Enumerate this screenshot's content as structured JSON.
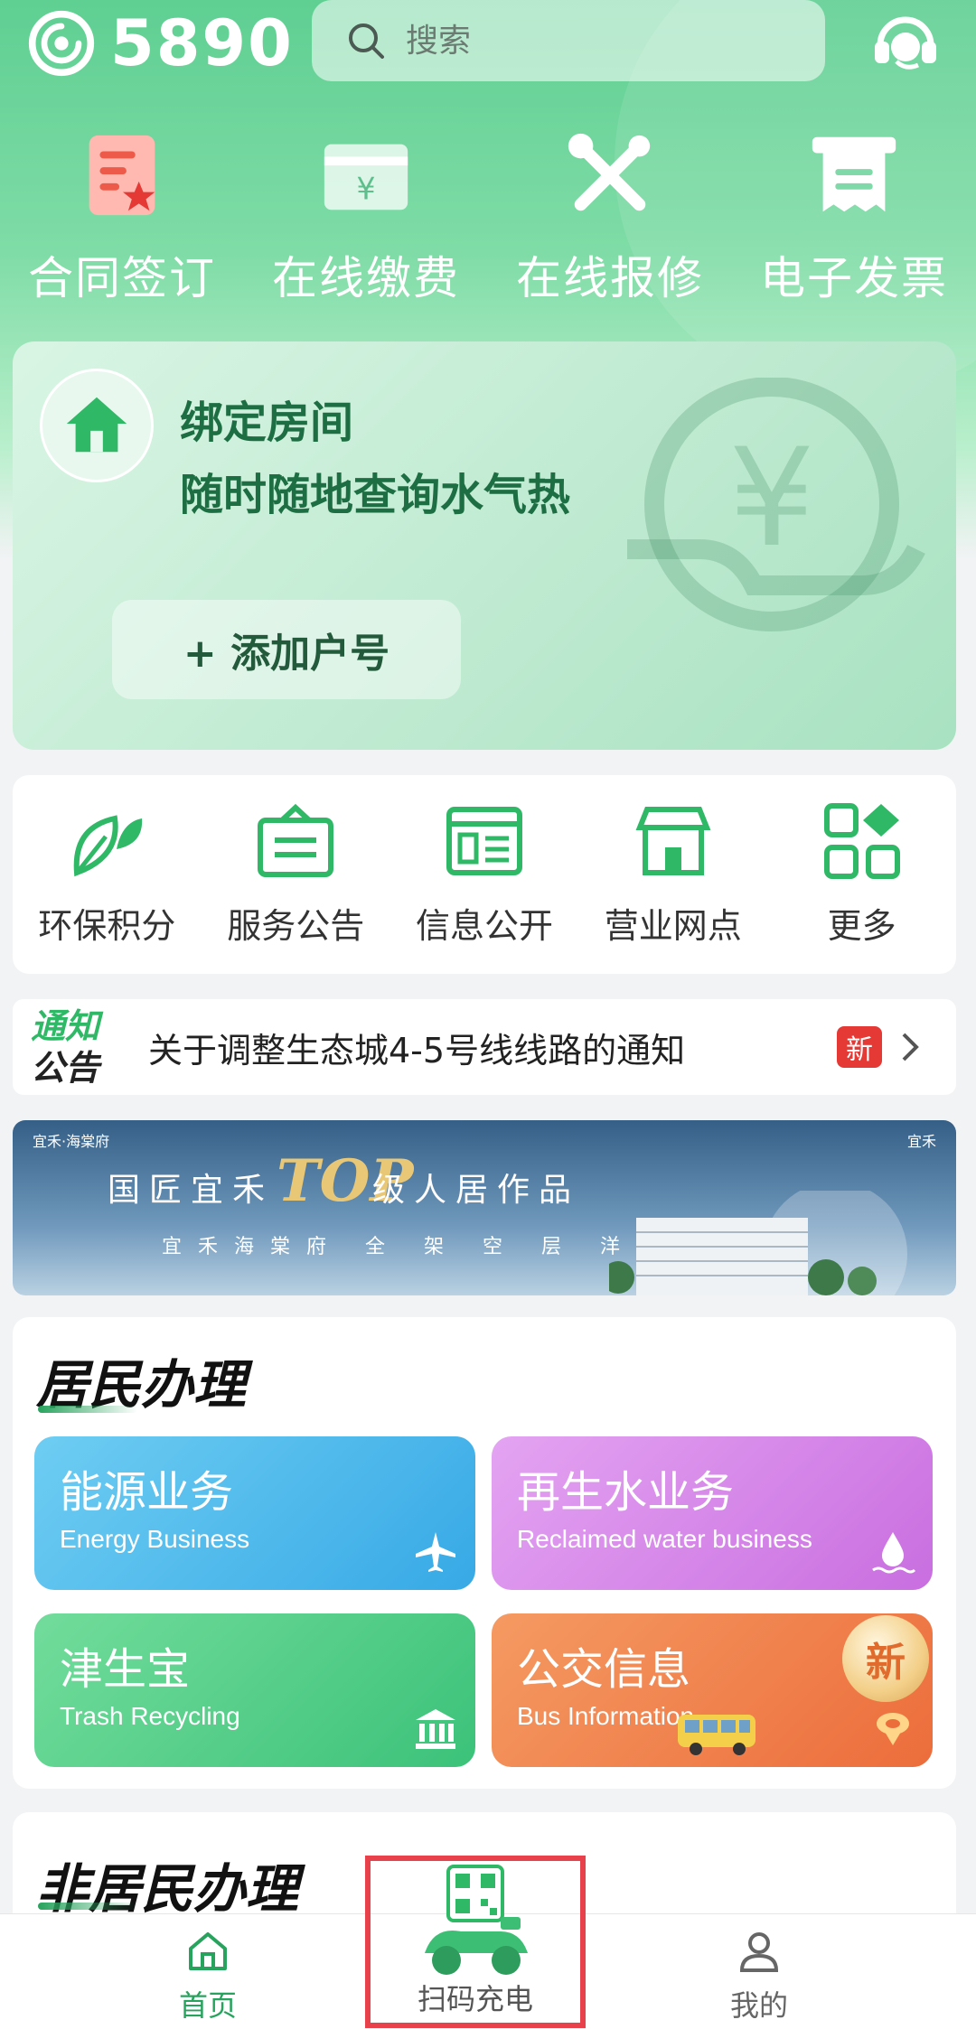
{
  "app": {
    "logo_text": "5890"
  },
  "search": {
    "placeholder": "搜索"
  },
  "quick_actions": [
    {
      "label": "合同签订",
      "icon": "contract-icon"
    },
    {
      "label": "在线缴费",
      "icon": "payment-icon"
    },
    {
      "label": "在线报修",
      "icon": "repair-tools-icon"
    },
    {
      "label": "电子发票",
      "icon": "invoice-icon"
    }
  ],
  "bind_card": {
    "title": "绑定房间",
    "subtitle": "随时随地查询水气热",
    "add_button": "+ 添加户号"
  },
  "services": [
    {
      "label": "环保积分",
      "icon": "leaf-icon"
    },
    {
      "label": "服务公告",
      "icon": "announcement-icon"
    },
    {
      "label": "信息公开",
      "icon": "info-board-icon"
    },
    {
      "label": "营业网点",
      "icon": "store-icon"
    },
    {
      "label": "更多",
      "icon": "more-grid-icon"
    }
  ],
  "notice": {
    "badge_top": "通知",
    "badge_bottom": "公告",
    "text": "关于调整生态城4-5号线线路的通知",
    "new_tag": "新"
  },
  "banner": {
    "brand_left": "宜禾·海棠府",
    "brand_right": "宜禾",
    "title_prefix": "国匠宜禾",
    "title_highlight": "TOP",
    "title_suffix": "级人居作品",
    "subtitle": "宜禾海棠府 全 架 空 层 洋 房"
  },
  "resident": {
    "title": "居民办理",
    "tiles": [
      {
        "title": "能源业务",
        "subtitle": "Energy Business",
        "icon": "plane-icon"
      },
      {
        "title": "再生水业务",
        "subtitle": "Reclaimed water business",
        "icon": "water-drop-icon"
      },
      {
        "title": "津生宝",
        "subtitle": "Trash Recycling",
        "icon": "bank-icon"
      },
      {
        "title": "公交信息",
        "subtitle": "Bus Information",
        "icon": "location-pin-icon",
        "badge": "新"
      }
    ]
  },
  "nonresident": {
    "title": "非居民办理"
  },
  "bottom_nav": {
    "home": "首页",
    "scan": "扫码充电",
    "mine": "我的"
  },
  "colors": {
    "primary_green": "#28a35d",
    "highlight_red": "#e8414b"
  }
}
